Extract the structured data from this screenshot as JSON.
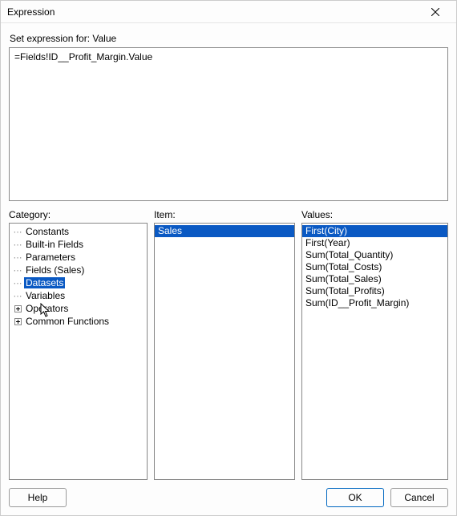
{
  "window": {
    "title": "Expression"
  },
  "setExpressionLabel": "Set expression for: Value",
  "expressionText": "=Fields!ID__Profit_Margin.Value",
  "columns": {
    "categoryLabel": "Category:",
    "itemLabel": "Item:",
    "valuesLabel": "Values:"
  },
  "categoryTree": [
    {
      "label": "Constants",
      "glyph": "dots",
      "selected": false
    },
    {
      "label": "Built-in Fields",
      "glyph": "dots",
      "selected": false
    },
    {
      "label": "Parameters",
      "glyph": "dots",
      "selected": false
    },
    {
      "label": "Fields (Sales)",
      "glyph": "dots",
      "selected": false
    },
    {
      "label": "Datasets",
      "glyph": "dots",
      "selected": true
    },
    {
      "label": "Variables",
      "glyph": "dots",
      "selected": false
    },
    {
      "label": "Operators",
      "glyph": "plus",
      "selected": false
    },
    {
      "label": "Common Functions",
      "glyph": "plus",
      "selected": false
    }
  ],
  "itemList": [
    {
      "label": "Sales",
      "selected": true
    }
  ],
  "valuesList": [
    {
      "label": "First(City)",
      "selected": true
    },
    {
      "label": "First(Year)",
      "selected": false
    },
    {
      "label": "Sum(Total_Quantity)",
      "selected": false
    },
    {
      "label": "Sum(Total_Costs)",
      "selected": false
    },
    {
      "label": "Sum(Total_Sales)",
      "selected": false
    },
    {
      "label": "Sum(Total_Profits)",
      "selected": false
    },
    {
      "label": "Sum(ID__Profit_Margin)",
      "selected": false
    }
  ],
  "buttons": {
    "help": "Help",
    "ok": "OK",
    "cancel": "Cancel"
  },
  "cursorOver": "Variables"
}
